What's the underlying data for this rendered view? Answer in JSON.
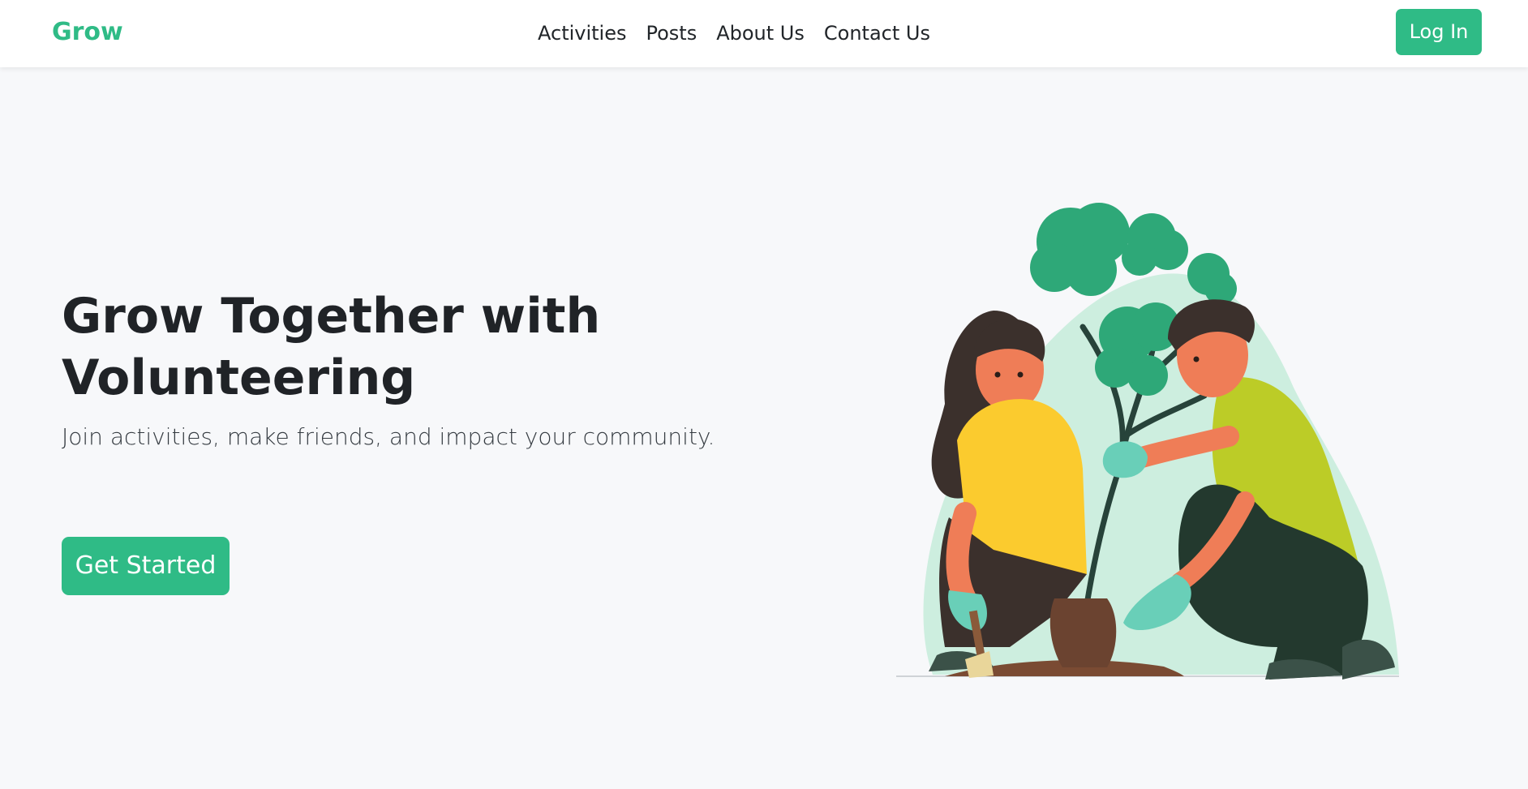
{
  "brand": {
    "name": "Grow",
    "color": "#2fbb86"
  },
  "nav": {
    "links": [
      "Activities",
      "Posts",
      "About Us",
      "Contact Us"
    ]
  },
  "header": {
    "login_label": "Log In"
  },
  "hero": {
    "title": "Grow Together with Volunteering",
    "subtitle": "Join activities, make friends, and impact your community.",
    "cta_label": "Get Started"
  },
  "illustration": {
    "subject": "volunteers-planting-tree"
  },
  "colors": {
    "accent": "#2fbb86",
    "background": "#f7f8fa",
    "text": "#212529"
  }
}
